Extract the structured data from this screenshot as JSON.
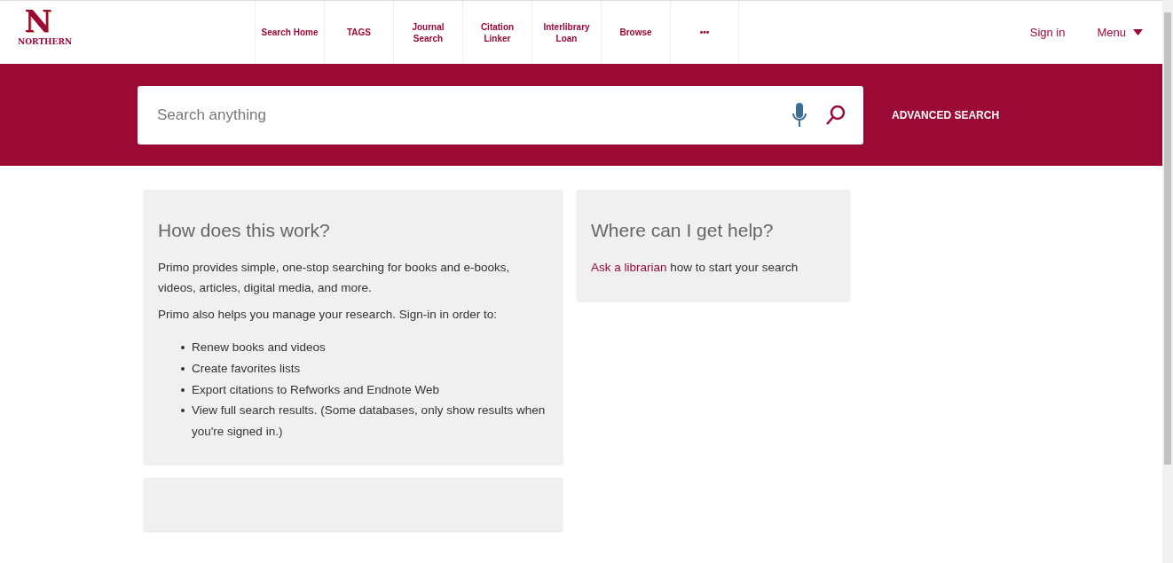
{
  "logo": {
    "letter": "N",
    "name": "NORTHERN"
  },
  "nav": [
    {
      "label": "Search Home"
    },
    {
      "label": "TAGS"
    },
    {
      "label": "Journal Search"
    },
    {
      "label": "Citation Linker"
    },
    {
      "label": "Interlibrary Loan"
    },
    {
      "label": "Browse"
    },
    {
      "label": "•••"
    }
  ],
  "user": {
    "sign_in": "Sign in",
    "menu": "Menu"
  },
  "search": {
    "placeholder": "Search anything",
    "advanced": "ADVANCED SEARCH"
  },
  "help_card": {
    "title": "How does this work?",
    "paragraphs": [
      "Primo provides simple, one-stop searching for books and e-books, videos, articles, digital media, and more.",
      "Primo also helps you manage your research. Sign-in in order to:"
    ],
    "items": [
      "Renew books and videos",
      "Create favorites lists",
      "Export citations to Refworks and Endnote Web",
      "View full search results. (Some databases, only show results when you're signed in.)"
    ]
  },
  "contact_card": {
    "title": "Where can I get help?",
    "link": "Ask a librarian",
    "text": " how to start your search"
  }
}
